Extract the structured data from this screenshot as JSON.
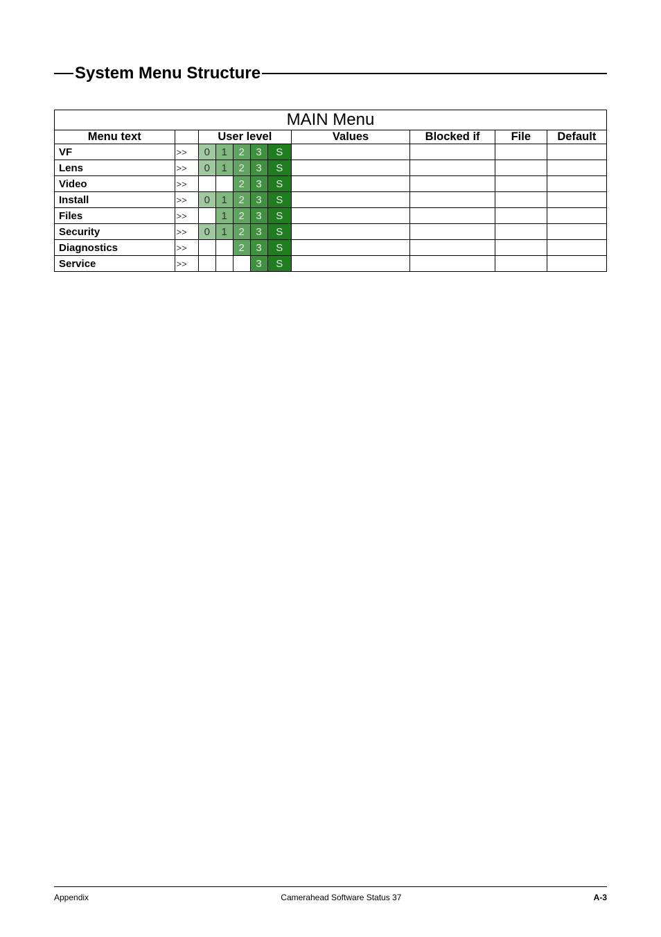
{
  "section_title": "System Menu Structure",
  "table": {
    "title": "MAIN Menu",
    "headers": {
      "menu_text": "Menu text",
      "user_level": "User level",
      "values": "Values",
      "blocked_if": "Blocked if",
      "file": "File",
      "default": "Default"
    },
    "rows": [
      {
        "name": "VF",
        "arrow": ">>",
        "levels": [
          "0",
          "1",
          "2",
          "3",
          "S"
        ],
        "values": "",
        "blocked": "",
        "file": "",
        "default": ""
      },
      {
        "name": "Lens",
        "arrow": ">>",
        "levels": [
          "0",
          "1",
          "2",
          "3",
          "S"
        ],
        "values": "",
        "blocked": "",
        "file": "",
        "default": ""
      },
      {
        "name": "Video",
        "arrow": ">>",
        "levels": [
          "",
          "",
          "2",
          "3",
          "S"
        ],
        "values": "",
        "blocked": "",
        "file": "",
        "default": ""
      },
      {
        "name": "Install",
        "arrow": ">>",
        "levels": [
          "0",
          "1",
          "2",
          "3",
          "S"
        ],
        "values": "",
        "blocked": "",
        "file": "",
        "default": ""
      },
      {
        "name": "Files",
        "arrow": ">>",
        "levels": [
          "",
          "1",
          "2",
          "3",
          "S"
        ],
        "values": "",
        "blocked": "",
        "file": "",
        "default": ""
      },
      {
        "name": "Security",
        "arrow": ">>",
        "levels": [
          "0",
          "1",
          "2",
          "3",
          "S"
        ],
        "values": "",
        "blocked": "",
        "file": "",
        "default": ""
      },
      {
        "name": "Diagnostics",
        "arrow": ">>",
        "levels": [
          "",
          "",
          "2",
          "3",
          "S"
        ],
        "values": "",
        "blocked": "",
        "file": "",
        "default": ""
      },
      {
        "name": "Service",
        "arrow": ">>",
        "levels": [
          "",
          "",
          "",
          "3",
          "S"
        ],
        "values": "",
        "blocked": "",
        "file": "",
        "default": ""
      }
    ]
  },
  "footer": {
    "left": "Appendix",
    "center": "Camerahead Software Status 37",
    "right": "A-3"
  }
}
